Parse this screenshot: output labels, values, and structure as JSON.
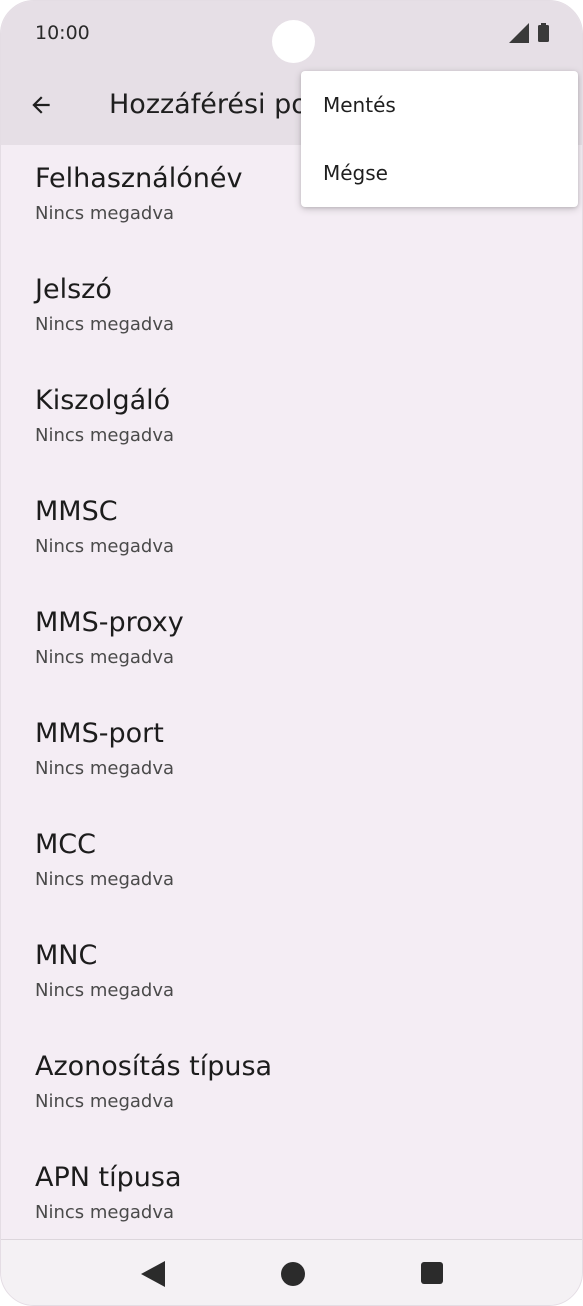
{
  "status_bar": {
    "time": "10:00",
    "icons": [
      "signal-icon",
      "battery-icon"
    ]
  },
  "app_bar": {
    "back_icon": "arrow-back-icon",
    "title": "Hozzáférési po"
  },
  "overflow_menu": {
    "items": [
      {
        "label": "Mentés"
      },
      {
        "label": "Mégse"
      }
    ]
  },
  "settings": {
    "items": [
      {
        "title": "Felhasználónév",
        "value": "Nincs megadva"
      },
      {
        "title": "Jelszó",
        "value": "Nincs megadva"
      },
      {
        "title": "Kiszolgáló",
        "value": "Nincs megadva"
      },
      {
        "title": "MMSC",
        "value": "Nincs megadva"
      },
      {
        "title": "MMS-proxy",
        "value": "Nincs megadva"
      },
      {
        "title": "MMS-port",
        "value": "Nincs megadva"
      },
      {
        "title": "MCC",
        "value": "Nincs megadva"
      },
      {
        "title": "MNC",
        "value": "Nincs megadva"
      },
      {
        "title": "Azonosítás típusa",
        "value": "Nincs megadva"
      },
      {
        "title": "APN típusa",
        "value": "Nincs megadva"
      }
    ]
  },
  "nav_bar": {
    "icons": [
      "nav-back-icon",
      "nav-home-icon",
      "nav-recents-icon"
    ]
  },
  "colors": {
    "background": "#f4edf4",
    "app_bar": "#e6dfe6",
    "text_primary": "#1c1c1c",
    "text_secondary": "#4a4a4a"
  }
}
